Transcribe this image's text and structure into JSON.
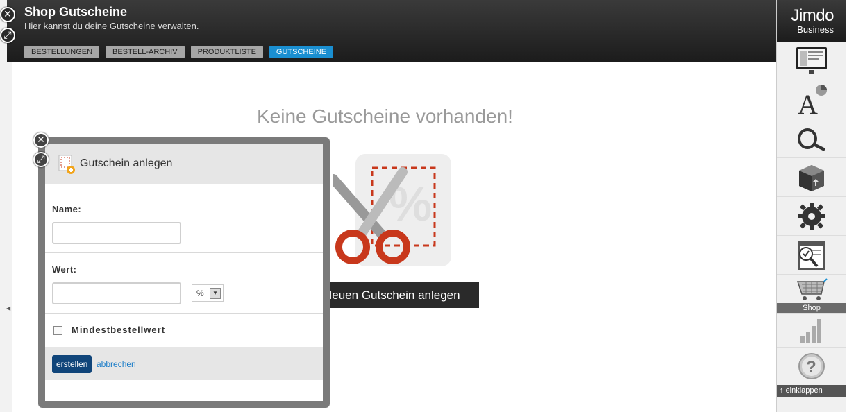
{
  "header": {
    "title": "Shop Gutscheine",
    "subtitle": "Hier kannst du deine Gutscheine verwalten.",
    "tabs": [
      "BESTELLUNGEN",
      "BESTELL-ARCHIV",
      "PRODUKTLISTE",
      "GUTSCHEINE"
    ],
    "active_tab": "GUTSCHEINE"
  },
  "brand": {
    "logo": "Jimdo",
    "plan": "Business"
  },
  "sidebar": {
    "items": [
      "layout-icon",
      "design-icon",
      "marketing-icon",
      "add-on-icon",
      "settings-icon",
      "seo-icon",
      "shop-cart-icon",
      "statistics-icon",
      "help-icon"
    ],
    "shop_label": "Shop",
    "collapse_label": "einklappen"
  },
  "main": {
    "empty_title": "Keine Gutscheine vorhanden!",
    "new_button": "Neuen Gutschein anlegen"
  },
  "dialog": {
    "title": "Gutschein anlegen",
    "name_label": "Name:",
    "name_value": "",
    "value_label": "Wert:",
    "value_value": "",
    "unit_selected": "%",
    "min_order_label": "Mindestbestellwert",
    "min_order_checked": false,
    "create_label": "erstellen",
    "cancel_label": "abbrechen"
  },
  "colors": {
    "active_tab": "#1a8fd1",
    "create_button": "#10457a",
    "accent_red": "#c8381c"
  }
}
